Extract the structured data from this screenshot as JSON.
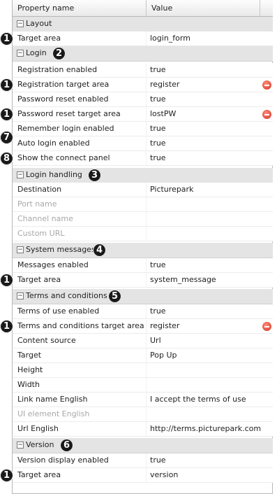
{
  "header": {
    "col_property": "Property name",
    "col_value": "Value"
  },
  "sections": [
    {
      "id": "layout",
      "title": "Layout",
      "toggle": "−"
    },
    {
      "id": "login",
      "title": "Login",
      "toggle": "−",
      "badge": "2"
    },
    {
      "id": "login_handling",
      "title": "Login handling",
      "toggle": "−",
      "badge": "3"
    },
    {
      "id": "system_messages",
      "title": "System messages",
      "toggle": "−",
      "badge": "4"
    },
    {
      "id": "terms",
      "title": "Terms and conditions",
      "toggle": "−",
      "badge": "5"
    },
    {
      "id": "version",
      "title": "Version",
      "toggle": "−",
      "badge": "6"
    }
  ],
  "rows": [
    {
      "name": "Target area",
      "value": "login_form",
      "badge": "1"
    },
    {
      "name": "Registration enabled",
      "value": "true"
    },
    {
      "name": "Registration target area",
      "value": "register",
      "badge": "1",
      "remove": "remove-icon"
    },
    {
      "name": "Password reset enabled",
      "value": "true"
    },
    {
      "name": "Password reset target area",
      "value": "lostPW",
      "badge": "1",
      "remove": "remove-icon"
    },
    {
      "name": "Remember login enabled",
      "value": "true"
    },
    {
      "name": "Auto login enabled",
      "value": "true",
      "badge": "7"
    },
    {
      "name": "Show the connect panel",
      "value": "true",
      "badge": "8"
    },
    {
      "name": "Destination",
      "value": "Picturepark"
    },
    {
      "name": "Port name",
      "value": ""
    },
    {
      "name": "Channel name",
      "value": ""
    },
    {
      "name": "Custom URL",
      "value": ""
    },
    {
      "name": "Messages enabled",
      "value": "true"
    },
    {
      "name": "Target area",
      "value": "system_message",
      "badge": "1"
    },
    {
      "name": "Terms of use enabled",
      "value": "true"
    },
    {
      "name": "Terms and conditions target area",
      "value": "register",
      "badge": "1",
      "remove": "remove-icon"
    },
    {
      "name": "Content source",
      "value": "Url"
    },
    {
      "name": "Target",
      "value": "Pop Up"
    },
    {
      "name": "Height",
      "value": ""
    },
    {
      "name": "Width",
      "value": ""
    },
    {
      "name": "Link name English",
      "value": "I accept the terms of use"
    },
    {
      "name": "UI element English",
      "value": ""
    },
    {
      "name": "Url English",
      "value": "http://terms.picturepark.com"
    },
    {
      "name": "Version display enabled",
      "value": "true"
    },
    {
      "name": "Target area",
      "value": "version",
      "badge": "1"
    }
  ],
  "colors": {
    "badge": "#1a1a1a",
    "remove": "#d23322",
    "section_bg": "#e4e4e4",
    "disabled_text": "#a8a8a8"
  }
}
